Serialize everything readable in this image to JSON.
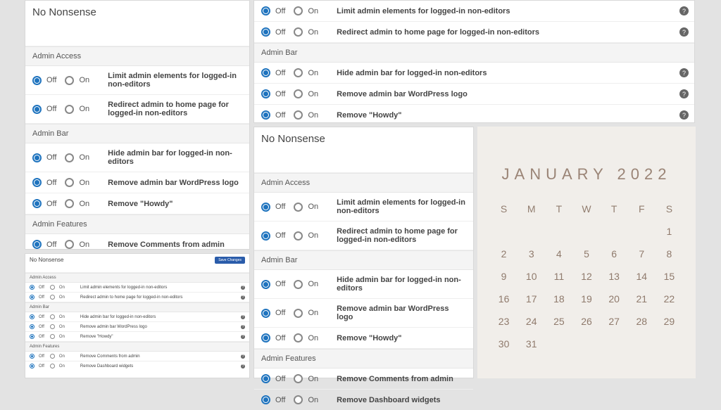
{
  "labels": {
    "off": "Off",
    "on": "On",
    "save": "Save Changes"
  },
  "pluginTitle": "No Nonsense",
  "sections": {
    "adminAccess": "Admin Access",
    "adminBar": "Admin Bar",
    "adminFeatures": "Admin Features"
  },
  "options": {
    "limitAdmin": "Limit admin elements for logged-in non-editors",
    "redirectAdmin": "Redirect admin to home page for logged-in non-editors",
    "hideAdminBar": "Hide admin bar for logged-in non-editors",
    "removeWpLogo": "Remove admin bar WordPress logo",
    "removeHowdy": "Remove \"Howdy\"",
    "removeComments": "Remove Comments from admin",
    "removeDashWidgets": "Remove Dashboard widgets"
  },
  "calendar": {
    "title": "JANUARY 2022",
    "dow": [
      "S",
      "M",
      "T",
      "W",
      "T",
      "F",
      "S"
    ],
    "leadingBlanks": 6,
    "days": 31
  }
}
